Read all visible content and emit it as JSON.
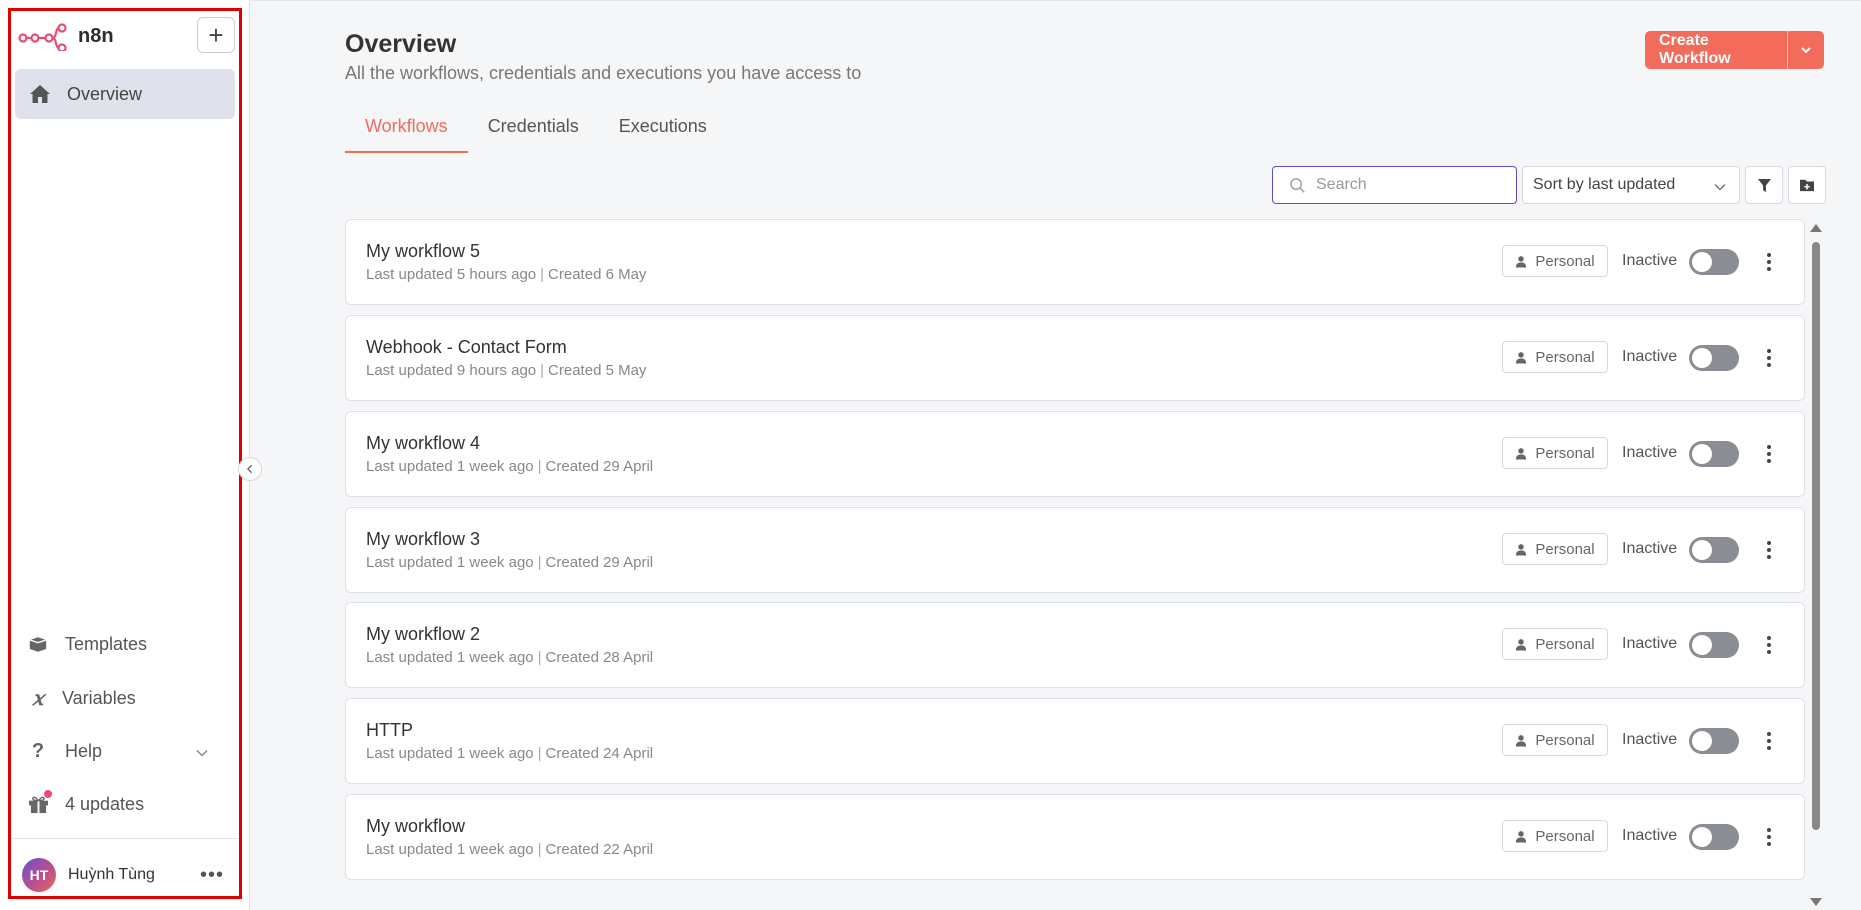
{
  "app": {
    "name": "n8n"
  },
  "sidebar": {
    "add_label": "+",
    "overview_label": "Overview",
    "templates_label": "Templates",
    "variables_label": "Variables",
    "help_label": "Help",
    "updates_label": "4 updates",
    "user": {
      "initials": "HT",
      "name": "Huỳnh Tùng"
    }
  },
  "header": {
    "title": "Overview",
    "subtitle": "All the workflows, credentials and executions you have access to",
    "create_button": "Create Workflow"
  },
  "tabs": [
    {
      "label": "Workflows",
      "active": true
    },
    {
      "label": "Credentials",
      "active": false
    },
    {
      "label": "Executions",
      "active": false
    }
  ],
  "toolbar": {
    "search_placeholder": "Search",
    "sort_value": "Sort by last updated"
  },
  "workflows": [
    {
      "title": "My workflow 5",
      "updated": "Last updated 5 hours ago",
      "created": "Created 6 May",
      "owner": "Personal",
      "status": "Inactive"
    },
    {
      "title": "Webhook - Contact Form",
      "updated": "Last updated 9 hours ago",
      "created": "Created 5 May",
      "owner": "Personal",
      "status": "Inactive"
    },
    {
      "title": "My workflow 4",
      "updated": "Last updated 1 week ago",
      "created": "Created 29 April",
      "owner": "Personal",
      "status": "Inactive"
    },
    {
      "title": "My workflow 3",
      "updated": "Last updated 1 week ago",
      "created": "Created 29 April",
      "owner": "Personal",
      "status": "Inactive"
    },
    {
      "title": "My workflow 2",
      "updated": "Last updated 1 week ago",
      "created": "Created 28 April",
      "owner": "Personal",
      "status": "Inactive"
    },
    {
      "title": "HTTP",
      "updated": "Last updated 1 week ago",
      "created": "Created 24 April",
      "owner": "Personal",
      "status": "Inactive"
    },
    {
      "title": "My workflow",
      "updated": "Last updated 1 week ago",
      "created": "Created 22 April",
      "owner": "Personal",
      "status": "Inactive"
    }
  ],
  "colors": {
    "accent": "#f26b5b",
    "search_border": "#5b4fc0",
    "toggle_off": "#8a8d94"
  }
}
